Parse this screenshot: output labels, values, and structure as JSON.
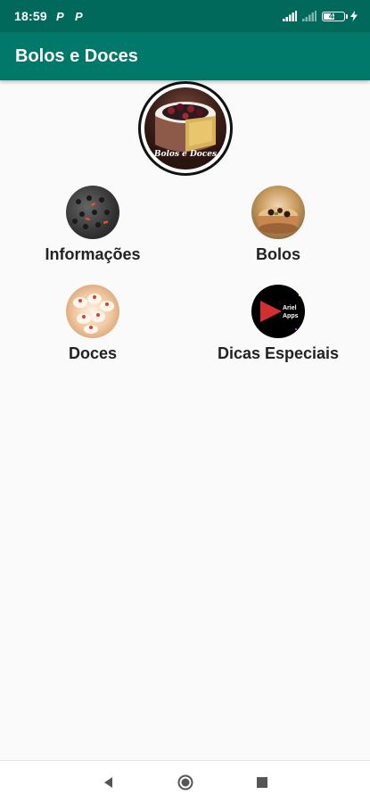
{
  "status_bar": {
    "time": "18:59",
    "notification_icons": [
      "P",
      "P"
    ],
    "battery_level": "48",
    "icons": [
      "signal-icon",
      "signal-weak-icon",
      "battery-icon",
      "charging-bolt-icon"
    ]
  },
  "app_bar": {
    "title": "Bolos e Doces",
    "color": "#00796b"
  },
  "logo": {
    "caption": "Bolos e Doces"
  },
  "menu": {
    "items": [
      {
        "label": "Informações",
        "icon": "informacoes-icon"
      },
      {
        "label": "Bolos",
        "icon": "bolos-icon"
      },
      {
        "label": "Doces",
        "icon": "doces-icon"
      },
      {
        "label": "Dicas Especiais",
        "icon": "dicas-especiais-icon"
      }
    ]
  },
  "dicas_logo": {
    "line1": "Ariel",
    "line2": "Apps"
  },
  "nav_bar": {
    "icons": [
      "back-icon",
      "home-icon",
      "recents-icon"
    ]
  },
  "colors": {
    "status_bar": "#00695c",
    "app_bar": "#00796b",
    "background": "#fafafa"
  }
}
